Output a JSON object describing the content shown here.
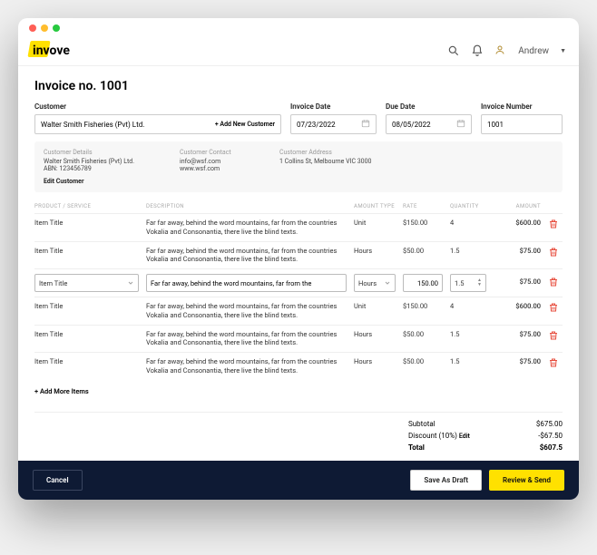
{
  "brand": "invove",
  "user": {
    "name": "Andrew"
  },
  "page": {
    "title": "Invoice no. 1001",
    "labels": {
      "customer": "Customer",
      "invoice_date": "Invoice Date",
      "due_date": "Due Date",
      "invoice_number": "Invoice Number",
      "add_new_customer": "+ Add New Customer",
      "add_more_items": "+ Add More Items"
    },
    "customer_value": "Walter Smith Fisheries (Pvt) Ltd.",
    "invoice_date": "07/23/2022",
    "due_date": "08/05/2022",
    "invoice_number": "1001"
  },
  "customer_card": {
    "details_lbl": "Customer Details",
    "details_name": "Walter Smith Fisheries (Pvt) Ltd.",
    "details_abn": "ABN: 123456789",
    "contact_lbl": "Customer Contact",
    "contact_email": "info@wsf.com",
    "contact_site": "www.wsf.com",
    "address_lbl": "Customer Address",
    "address": "1 Collins St, Melbourne VIC 3000",
    "edit": "Edit Customer"
  },
  "columns": {
    "item": "PRODUCT / SERVICE",
    "desc": "DESCRIPTION",
    "atype": "AMOUNT TYPE",
    "rate": "RATE",
    "qty": "QUANTITY",
    "amt": "AMOUNT"
  },
  "lines": [
    {
      "item": "Item Title",
      "desc": "Far far away, behind the word mountains, far from the countries Vokalia and Consonantia, there live the blind texts.",
      "atype": "Unit",
      "rate": "$150.00",
      "qty": "4",
      "amt": "$600.00"
    },
    {
      "item": "Item Title",
      "desc": "Far far away, behind the word mountains, far from the countries Vokalia and Consonantia, there live the blind texts.",
      "atype": "Hours",
      "rate": "$50.00",
      "qty": "1.5",
      "amt": "$75.00"
    },
    {
      "item": "Item Title",
      "desc": "Far far away, behind the word mountains, far from the",
      "atype": "Hours",
      "rate": "150.00",
      "qty": "1.5",
      "amt": "$75.00",
      "editing": true
    },
    {
      "item": "Item Title",
      "desc": "Far far away, behind the word mountains, far from the countries Vokalia and Consonantia, there live the blind texts.",
      "atype": "Unit",
      "rate": "$150.00",
      "qty": "4",
      "amt": "$600.00"
    },
    {
      "item": "Item Title",
      "desc": "Far far away, behind the word mountains, far from the countries Vokalia and Consonantia, there live the blind texts.",
      "atype": "Hours",
      "rate": "$50.00",
      "qty": "1.5",
      "amt": "$75.00"
    },
    {
      "item": "Item Title",
      "desc": "Far far away, behind the word mountains, far from the countries Vokalia and Consonantia, there live the blind texts.",
      "atype": "Hours",
      "rate": "$50.00",
      "qty": "1.5",
      "amt": "$75.00"
    }
  ],
  "totals": {
    "subtotal_lbl": "Subtotal",
    "subtotal": "$675.00",
    "discount_lbl": "Discount (10%)",
    "discount": "-$67.50",
    "edit": "Edit",
    "total_lbl": "Total",
    "total": "$607.5"
  },
  "footer": {
    "cancel": "Cancel",
    "draft": "Save As Draft",
    "send": "Review & Send"
  }
}
